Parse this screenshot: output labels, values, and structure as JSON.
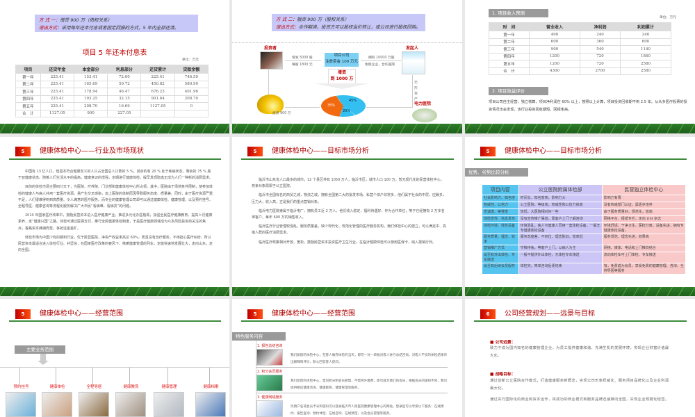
{
  "slide1": {
    "mode_label": "方 式 一：",
    "mode_text": "借贷 900 万（债权关系）",
    "exit_label": "退出方式：",
    "exit_text": "采用每年还本付息或者固定回报的方式，5 年内全部还清。",
    "table_title": "项目 5 年还本付息表",
    "unit": "单位：万元",
    "headers": [
      "项目",
      "还贷年金",
      "本金部分",
      "利息部分",
      "还贷累计",
      "贷款余额"
    ],
    "rows": [
      [
        "第一年",
        "225.41",
        "153.41",
        "72.00",
        "225.41",
        "746.59"
      ],
      [
        "第二年",
        "225.41",
        "165.69",
        "59.72",
        "450.82",
        "580.90"
      ],
      [
        "第三年",
        "225.41",
        "178.94",
        "46.47",
        "676.23",
        "401.96"
      ],
      [
        "第四年",
        "225.41",
        "193.25",
        "32.15",
        "901.64",
        "208.70"
      ],
      [
        "第五年",
        "225.41",
        "208.70",
        "16.69",
        "1127.05",
        "0"
      ],
      [
        "合　计",
        "1127.05",
        "900",
        "227.05",
        "",
        ""
      ]
    ]
  },
  "slide2": {
    "mode_label": "方 式 二：",
    "mode_text": "融资 900 万（股权关系）",
    "exit_label": "退出方式：",
    "exit_text": "合作期满，投资方可以股权溢价转让，或公司进行股权回购。",
    "investor": "投资者",
    "founder": "发起人",
    "issue_line1": "增发 5000 股",
    "issue_line2": "每股 1800 元",
    "company_line1": "项目公司",
    "company_line2": "注册资金 100 万元",
    "own_line1": "拥有 10000 万股",
    "own_line2": "免税企业，合作医院",
    "increase_line1": "增资",
    "increase_line2": "到 1000 万",
    "invest_text": "投资 900 万",
    "intangible": "无形资产",
    "hospital": "电力医院",
    "pie": [
      {
        "label": "35%",
        "value": 35,
        "color": "#f26a10"
      },
      {
        "label": "45%",
        "value": 45,
        "color": "#33c0f0"
      },
      {
        "label": "20%",
        "value": 20,
        "color": "#33c0f0"
      }
    ]
  },
  "slide3": {
    "section1": "1. 项目收入预测",
    "unit": "单位：万元",
    "headers": [
      "时　间",
      "营业收入",
      "净利润",
      "利润累计"
    ],
    "rows": [
      [
        "第一年",
        "400",
        "240",
        "240"
      ],
      [
        "第二年",
        "600",
        "360",
        "600"
      ],
      [
        "第三年",
        "900",
        "540",
        "1140"
      ],
      [
        "第四年",
        "1200",
        "720",
        "1860"
      ],
      [
        "第五年",
        "1200",
        "720",
        "2580"
      ],
      [
        "合　计",
        "4300",
        "2700",
        "2580"
      ]
    ],
    "section2": "2. 项目效益评价",
    "paragraph": "项目公司自主经营，独立核算，项目净利润在 60% 以上，按照以上计算，项目投资回收期不到 2.5 年。从众多医疗股票的投资情况也会发现，该行业投资回收期短，回报率高。"
  },
  "slide4": {
    "badge": "5",
    "title": "健康体检中心——行业及市场现状",
    "paragraphs": [
      "中国有 13 亿人口，但基本符合健康定义的人只占全国总人口数的 5 %，其余的有 20 % 处于疾病状态，剩余的 75 % 属于亚健康状态。随着人们生活水平的提高，健康意识的增强，定期进行健康体检，提早发现隐患正成为人们一种新的消费需求。",
      "目前的体检市场主要四分天下，为医院、疗养院、门诊部和健康体检中心所占领。其中，医院由于场地条件限制，使参加体检的健康人与病人共用一套医疗资源，易产生交叉感染，加上医院的体制原因导致服务态度、质量差。同时，由于医疗资源严重不足，人们很难得到到高质量、令人满意的医疗服务。而专业的健康管理公司却可以通过健康体检、健康管理，以及预约挂号、全程导医、健康咨询等流程化服务解决广大市民“看病难，看病贵”的问题。",
      "2010 年国家医疗改革中，鼓励民营资本进入医疗健康产业，推进多元化办医格局，加强全民医疗健康教育，提高人们健康素养，走“健康兴国”之路。体检可通过医保支付，推行全民健康体检制度，于是医疗健康领域成为众多风险投资商关注的焦点，各路资本蜂拥而至，争抢这座金矿。",
      "体检市场为中国少有的暴利行业，优于民营医院，净资产收益率高达 60%，而且没有治疗服务，不用担心医疗纠纷，所以民营资本最适合进入体检行业。并坚信，在国家医疗改革的春风下，搭乘健康管理的列车，定能快速地发展壮大，走向山东，走向全国。"
    ]
  },
  "slide5": {
    "badge": "5",
    "title": "健康体检中心——目标市场分析",
    "paragraphs": [
      "临沂市山东省人口最多的城市，12 个县区共有 1050 万人，临沂市区，城市人口 100 万，暂无现代化的民营体检中心，竞争对象局限于公立医院。",
      "临沂市全国有名的商贸之城，物流之城，拥有全国第二大的批发市场，私营个体户非常多，他们属于社会的中层，应酬多，压力大，收入高，正是我们的重点营销对象。",
      "临沂电力医院隶属于临沂电厂，拥有员工近 2 万人，他们收入稳定，福利待遇好，作为合作单位，等于已经拥有 2 万多名准客户，每年 600 万的销售收入。",
      "临沂医疗行业管理较混乱，服务质量差，缺少现代化、规范化管理的医疗服务机构，我们体检中心的建立，可以满足中、高端人群的医疗消费需求。",
      "临沂医疗政策相对开放、宽松，鼓励民营资本投资医疗卫生行业，在临沂健康体检可以使用医保卡，纳入报销行列。"
    ]
  },
  "slide6": {
    "badge": "5",
    "title": "健康体检中心——目标市场分析",
    "section": "优势、劣势比较分析",
    "headers": [
      "项目内容",
      "公立医院附属体检部",
      "民营独立体检中心"
    ],
    "rows": [
      [
        "社会影响力、知名度",
        "时间长、知名度高，影响力大",
        "影响力有限"
      ],
      [
        "权威性、公信力",
        "公立医院，等级高，权威性和公信力就高",
        "没有权威部门认证，需逐步培养"
      ],
      [
        "忠诚度、美誉度",
        "较低，大医院相对好一些",
        "由于服务质量好，规范化，较高"
      ],
      [
        "体检宣传、信息发布",
        "没有宣传推广渠道，靠客户上门了解咨询",
        "网络平台、报纸专栏，定向 DM 杂志"
      ],
      [
        "体检环境、体检设备",
        "环境混乱，病人与健康人同用一套体检设备，一般无专健康体检设备",
        "环境舒适，干净卫生，医检分离，设备先进，拥有专健康体检设备。"
      ],
      [
        "服务质量、理念、效率",
        "服务态度差、不到位，理念陈旧，效率低",
        "服务规范，理念先进，效果高"
      ],
      [
        "营销推广方式",
        "守株待兔，等客户上门，以病人为主",
        "网络、媒体、电话和上门推向结合"
      ],
      [
        "是否有外出体检、专车接送",
        "一般不提供外出体检，无体检专车接送",
        "流动体检车可上门体检、专车接送"
      ],
      [
        "是否有后续会员服务",
        "体检完，简单咨询后便结束",
        "有，免费成为会员，享受免费的健康管理、咨询、全称导医等服务"
      ]
    ]
  },
  "slide7": {
    "badge": "5",
    "title": "健康体检中心——经营范围",
    "section": "主要业务范围",
    "services": [
      "预约挂号",
      "健康体检",
      "全程导医",
      "健康教育",
      "健康管理",
      "健康档案"
    ]
  },
  "slide8": {
    "badge": "5",
    "title": "健康体检中心——经营范围",
    "section": "特色服务内容",
    "items": [
      {
        "title": "1. 报告总结咨询",
        "text": "我们新建的体检中心，在客人做完体检的当天，即可一对一单独对客人进行总结咨询，对客人不良的体检结果作出解释和评价，耐心回答客人提问。"
      },
      {
        "title": "2. 积分会员服务",
        "text": "我们新建的体检中心，首创积分制会员管理，不需另外缴费，即可成为我们的会员，根据会员的级别不同，我们提供相应健康咨询、健康教育、健康管理等服务。"
      },
      {
        "title": "3. 健康网络服务",
        "text": "凭用户名或会员卡号和密码可以登录临沂市人民医院健康管理中心的网站，登录后可以享受以下服务：在线预约、报告查询、预约体检、在线咨询、在线预定，以及会员管理等服务。"
      }
    ]
  },
  "slide9": {
    "badge": "6",
    "title": "公司经营规划——远景与目标",
    "vision_label": "公司远景：",
    "vision_text": "致力于成为国内知名的健康管理企业，为员工提供健康和谐、充满生机的发展环境，实现企业财富价值最大化。",
    "goal_label": "战略目标：",
    "goal_text1": "通过创新公立医院合作模式，打造健康服务新概念，实现公司形象权威化、服务项目品牌化以及企业利润最大化。",
    "goal_text2": "通过实行国际化的商业和资本运作，将成功的商业模式和服务品牌迅速推向全国，实现企业规模化经营。"
  }
}
